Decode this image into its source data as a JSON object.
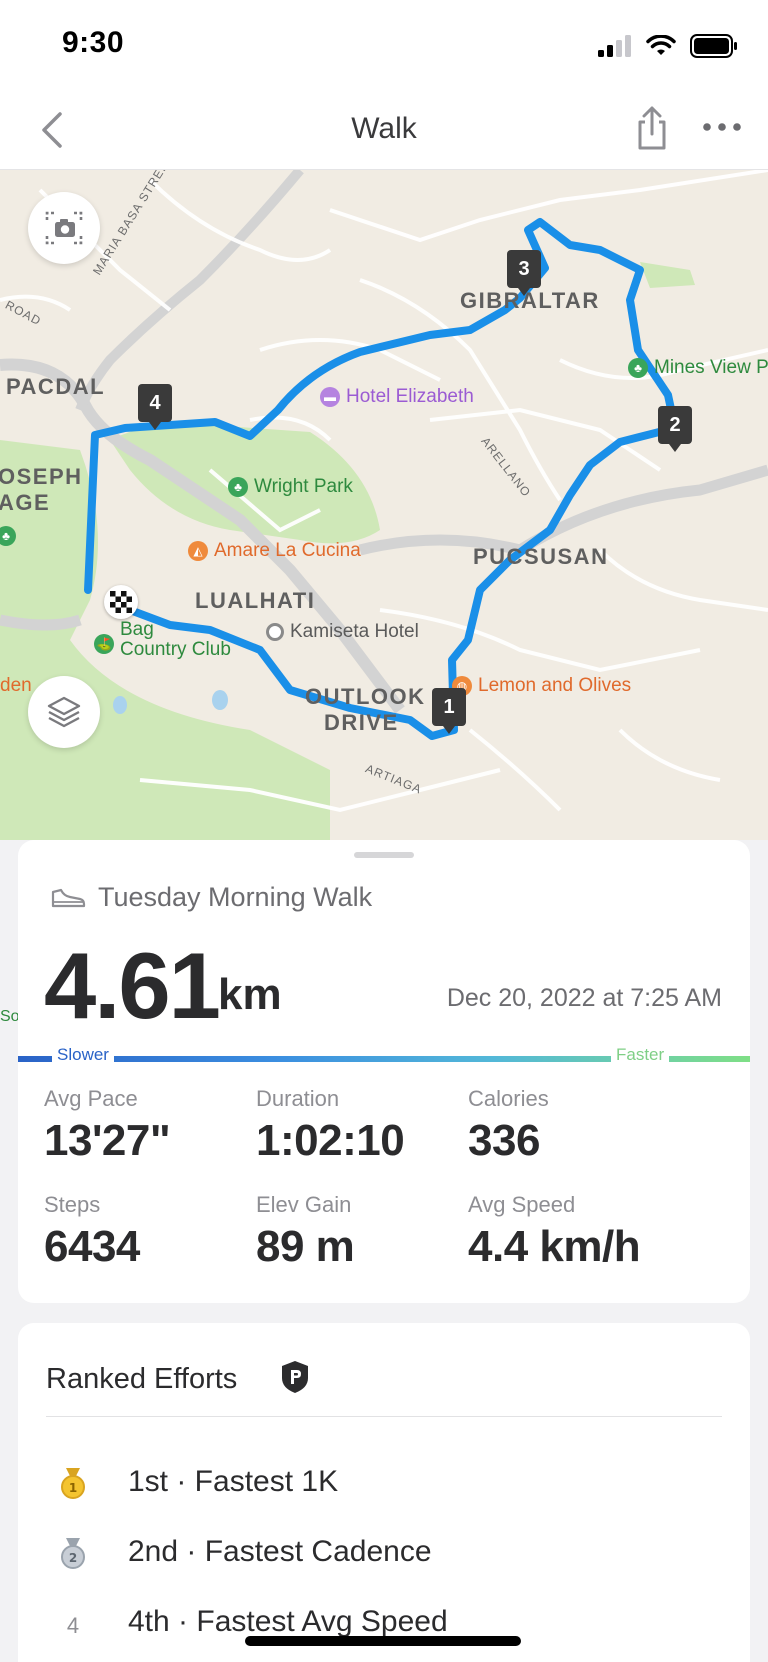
{
  "status_bar": {
    "time": "9:30"
  },
  "nav": {
    "title": "Walk"
  },
  "map": {
    "areas": [
      "GIBRALTAR",
      "PACDAL",
      "LUALHATI",
      "PUCSUSAN",
      "OUTLOOK",
      "DRIVE",
      "OSEPH",
      "AGE"
    ],
    "streets": [
      "MARIA BASA STREET",
      "ROAD",
      "ARELLANO",
      "ARTIAGA"
    ],
    "pois": {
      "hotel_elizabeth": "Hotel Elizabeth",
      "wright_park": "Wright Park",
      "amare": "Amare La Cucina",
      "kamiseta": "Kamiseta Hotel",
      "baguio_cc": "Baguio Country Club",
      "baguio_cc_line1": "Bag",
      "baguio_cc_line2": "Country Club",
      "lemon_olives": "Lemon and Olives",
      "mines_view": "Mines View P",
      "partial_den": "den",
      "partial_sol": "Sol"
    },
    "split_markers": [
      "1",
      "2",
      "3",
      "4"
    ],
    "colors": {
      "route": "#1a8fe8",
      "park": "#cfe8b8",
      "land": "#f1ece3"
    }
  },
  "activity": {
    "name": "Tuesday Morning Walk",
    "distance": "4.61",
    "distance_unit": "km",
    "date": "Dec 20, 2022 at 7:25 AM",
    "pace_slower": "Slower",
    "pace_faster": "Faster",
    "stats": [
      {
        "label": "Avg Pace",
        "value": "13'27\""
      },
      {
        "label": "Duration",
        "value": "1:02:10"
      },
      {
        "label": "Calories",
        "value": "336"
      },
      {
        "label": "Steps",
        "value": "6434"
      },
      {
        "label": "Elev Gain",
        "value": "89 m"
      },
      {
        "label": "Avg Speed",
        "value": "4.4 km/h"
      }
    ]
  },
  "ranked_efforts": {
    "title": "Ranked Efforts",
    "items": [
      {
        "rank": "1",
        "medal": "gold-medal-icon",
        "text": "1st · Fastest 1K"
      },
      {
        "rank": "2",
        "medal": "silver-medal-icon",
        "text": "2nd · Fastest Cadence"
      },
      {
        "rank": "4",
        "medal": "none",
        "text": "4th · Fastest Avg Speed"
      }
    ]
  }
}
